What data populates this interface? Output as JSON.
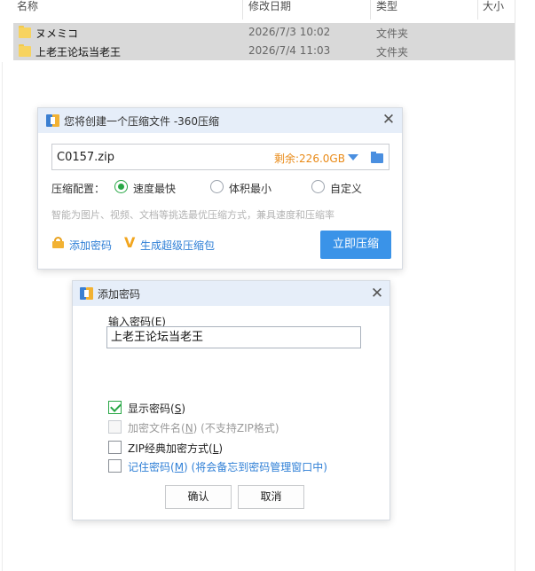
{
  "explorer": {
    "columns": {
      "name": "名称",
      "date": "修改日期",
      "type": "类型",
      "size": "大小"
    },
    "rows": [
      {
        "name": "ヌメミコ",
        "date": "2026/7/3 10:02",
        "type": "文件夹"
      },
      {
        "name": "上老王论坛当老王",
        "date": "2026/7/4 11:03",
        "type": "文件夹"
      }
    ]
  },
  "compress_dialog": {
    "title": "您将创建一个压缩文件 -360压缩",
    "filename": "C0157.zip",
    "free_space": "剩余:226.0GB",
    "config_label": "压缩配置：",
    "options": [
      "速度最快",
      "体积最小",
      "自定义"
    ],
    "selected_option": "速度最快",
    "hint": "智能为图片、视频、文档等挑选最优压缩方式，兼具速度和压缩率",
    "add_password": "添加密码",
    "super_pack": "生成超级压缩包",
    "compress_now": "立即压缩"
  },
  "password_dialog": {
    "title": "添加密码",
    "input_label": "输入密码(",
    "input_label_key": "E",
    "input_label_end": ")",
    "password_value": "上老王论坛当老王",
    "show_password": {
      "label": "显示密码(",
      "key": "S",
      "end": ")",
      "checked": true
    },
    "encrypt_names": {
      "label": "加密文件名(",
      "key": "N",
      "end": ")",
      "note": " (不支持ZIP格式)",
      "checked": false,
      "disabled": true
    },
    "zip_classic": {
      "label": "ZIP经典加密方式(",
      "key": "L",
      "end": ")",
      "checked": false
    },
    "remember": {
      "label": "记住密码(",
      "key": "M",
      "end": ")",
      "note": " (将会备忘到密码管理窗口中)",
      "checked": false
    },
    "ok": "确认",
    "cancel": "取消"
  },
  "colors": {
    "accent": "#3a93e8",
    "link": "#2f7fd6",
    "check_green": "#28a745",
    "warning_orange": "#e98a17",
    "selection": "#d9d9d9",
    "titlebar": "#e6eef9"
  },
  "icons": [
    "folder-icon",
    "archive-app-icon",
    "close-icon",
    "dropdown-arrow-icon",
    "lock-icon",
    "v-badge-icon",
    "checkmark-icon"
  ]
}
